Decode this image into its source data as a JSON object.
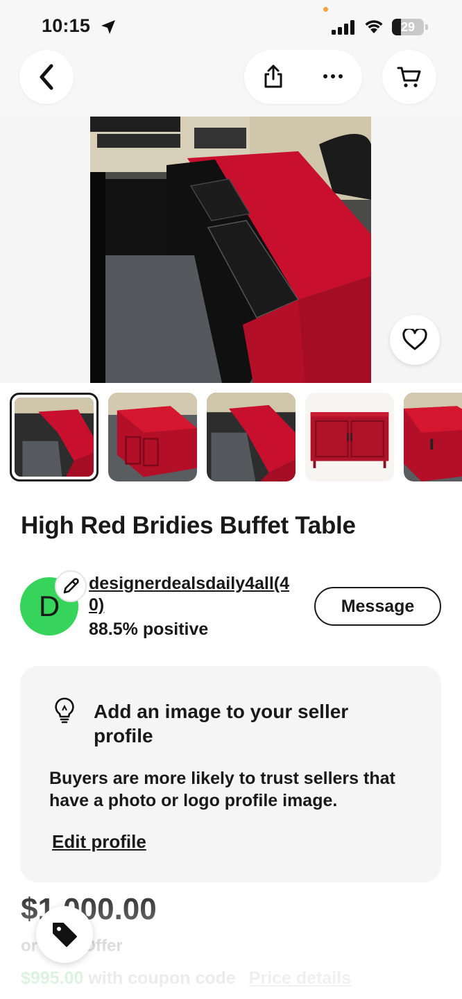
{
  "status_bar": {
    "time": "10:15",
    "battery": "29",
    "battery_level": 0.29
  },
  "header": {
    "back": "chevron-left-icon",
    "share": "share-icon",
    "more": "more-horizontal-icon",
    "cart": "cart-icon"
  },
  "listing": {
    "title": "High Red Bridies Buffet Table",
    "thumbnail_count": 5,
    "selected_thumbnail": 0
  },
  "seller": {
    "avatar_initial": "D",
    "avatar_color": "#36d45a",
    "name": "designerdealsdaily4all",
    "count": "(40)",
    "feedback": "88.5% positive",
    "message_label": "Message"
  },
  "tip_card": {
    "heading": "Add an image to your seller profile",
    "body": "Buyers are more likely to trust sellers that have a photo or logo profile image.",
    "link": "Edit profile"
  },
  "pricing": {
    "price": "$1,000.00",
    "offer": "or Best Offer",
    "coupon_price": "$995.00",
    "coupon_text": "with coupon code",
    "price_details": "Price details"
  },
  "colors": {
    "accent_red": "#c8102e",
    "avatar_green": "#36d45a",
    "coupon_green": "#9fdca9"
  }
}
